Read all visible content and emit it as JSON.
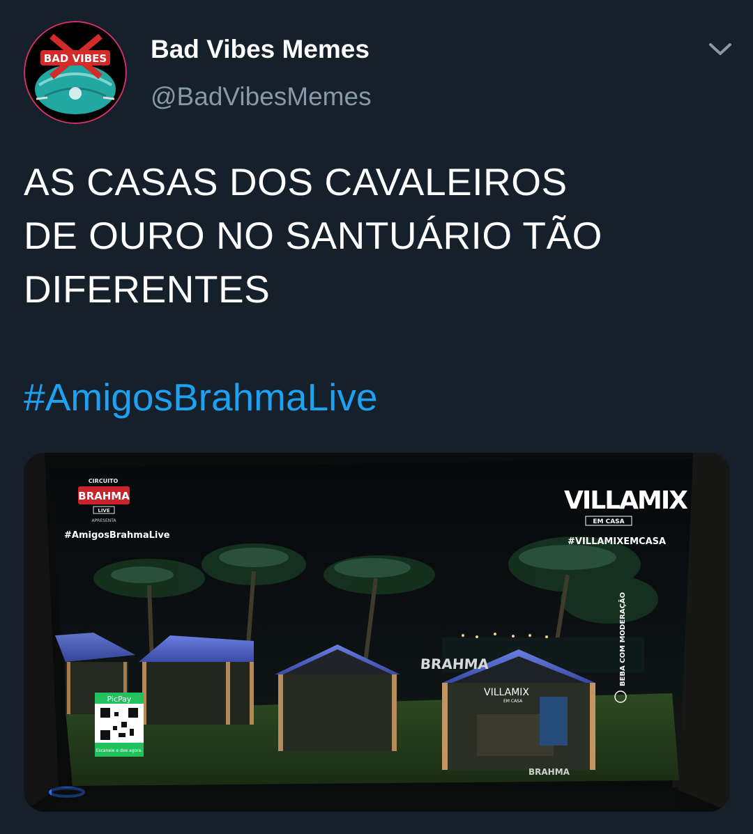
{
  "tweet": {
    "display_name": "Bad Vibes Memes",
    "handle": "@BadVibesMemes",
    "avatar_label": "BAD VIBES",
    "text_lines": [
      "AS CASAS DOS CAVALEIROS",
      "DE OURO NO SANTUÁRIO TÃO",
      "DIFERENTES"
    ],
    "hashtag": "#AmigosBrahmaLive",
    "menu_icon": "chevron-down-icon"
  },
  "media": {
    "tv_overlay": {
      "circuito_label": "CIRCUITO",
      "brahma_logo": "BRAHMA",
      "live_label": "LIVE",
      "apresenta_label": "APRESENTA",
      "hashtag_left": "#AmigosBrahmaLive",
      "villamix_logo": "VILLAMIX",
      "em_casa": "EM CASA",
      "hashtag_right": "#VILLAMIXEMCASA",
      "side_notice": "BEBA COM MODERAÇÃO",
      "picpay_label": "PicPay",
      "picpay_caption": "Escaneie e doe agora.",
      "stage_brahma": "BRAHMA",
      "house_villamix_small": "VILLAMIX",
      "house_villamix_em_casa": "EM CASA",
      "house_bottom_brahma": "BRAHMA"
    }
  },
  "colors": {
    "background": "#15202b",
    "text": "#ffffff",
    "secondary": "#8899a6",
    "link": "#1da1f2"
  }
}
